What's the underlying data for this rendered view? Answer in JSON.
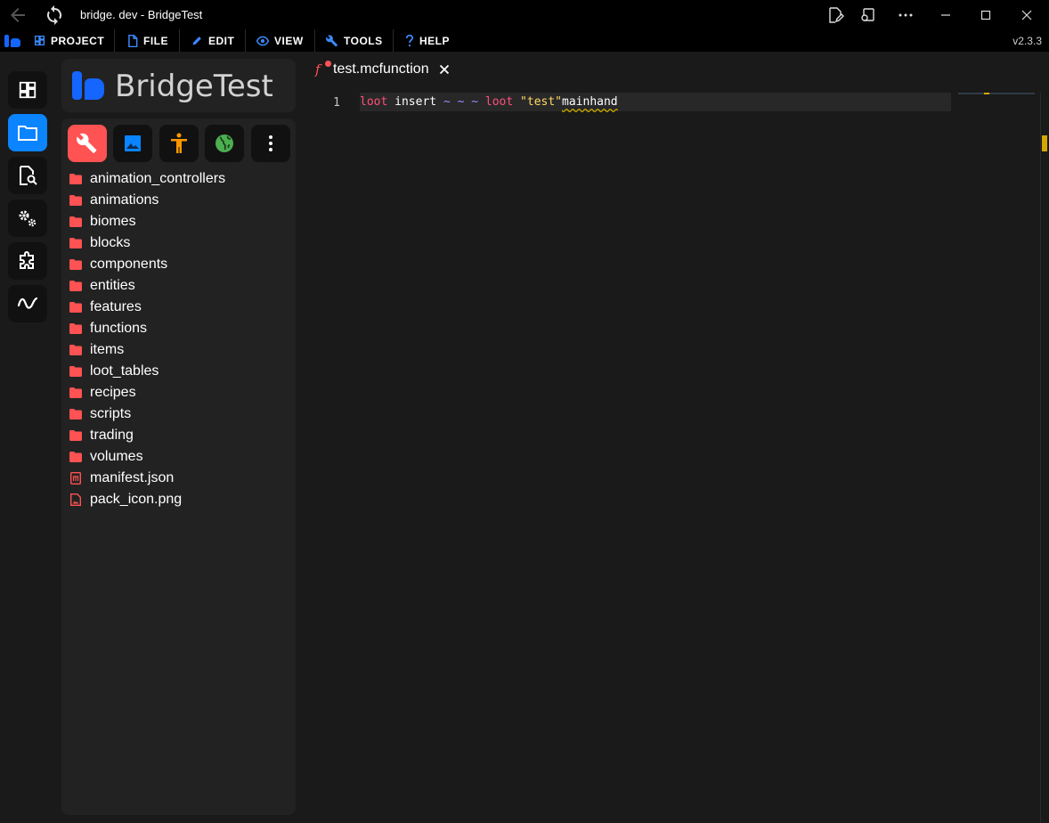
{
  "window": {
    "title": "bridge. dev - BridgeTest"
  },
  "menu": {
    "items": [
      {
        "label": "PROJECT",
        "icon": "dashboard-icon"
      },
      {
        "label": "FILE",
        "icon": "file-icon"
      },
      {
        "label": "EDIT",
        "icon": "pencil-icon"
      },
      {
        "label": "VIEW",
        "icon": "eye-icon"
      },
      {
        "label": "TOOLS",
        "icon": "wrench-icon"
      },
      {
        "label": "HELP",
        "icon": "question-icon"
      }
    ],
    "version": "v2.3.3"
  },
  "sidebar": {
    "project_name": "BridgeTest",
    "pack_tabs": [
      {
        "icon": "wrench-icon",
        "color": "#ff5252",
        "active": true
      },
      {
        "icon": "image-icon",
        "color": "#0a84ff"
      },
      {
        "icon": "person-icon",
        "color": "#ff9800"
      },
      {
        "icon": "globe-icon",
        "color": "#4caf50"
      },
      {
        "icon": "more-vertical-icon",
        "color": "#ffffff"
      }
    ],
    "tree": [
      {
        "label": "animation_controllers",
        "type": "folder"
      },
      {
        "label": "animations",
        "type": "folder"
      },
      {
        "label": "biomes",
        "type": "folder"
      },
      {
        "label": "blocks",
        "type": "folder"
      },
      {
        "label": "components",
        "type": "folder"
      },
      {
        "label": "entities",
        "type": "folder"
      },
      {
        "label": "features",
        "type": "folder"
      },
      {
        "label": "functions",
        "type": "folder"
      },
      {
        "label": "items",
        "type": "folder"
      },
      {
        "label": "loot_tables",
        "type": "folder"
      },
      {
        "label": "recipes",
        "type": "folder"
      },
      {
        "label": "scripts",
        "type": "folder"
      },
      {
        "label": "trading",
        "type": "folder"
      },
      {
        "label": "volumes",
        "type": "folder"
      },
      {
        "label": "manifest.json",
        "type": "json"
      },
      {
        "label": "pack_icon.png",
        "type": "image"
      }
    ]
  },
  "editor": {
    "tab_label": "test.mcfunction",
    "line_number": "1",
    "code": {
      "kw1": "loot",
      "cmd": "insert",
      "t1": "~",
      "t2": "~",
      "t3": "~",
      "kw2": "loot",
      "str": "\"test\"",
      "rest": "mainhand"
    }
  },
  "colors": {
    "accent": "#0a84ff",
    "behavior_pack": "#ff5252"
  }
}
